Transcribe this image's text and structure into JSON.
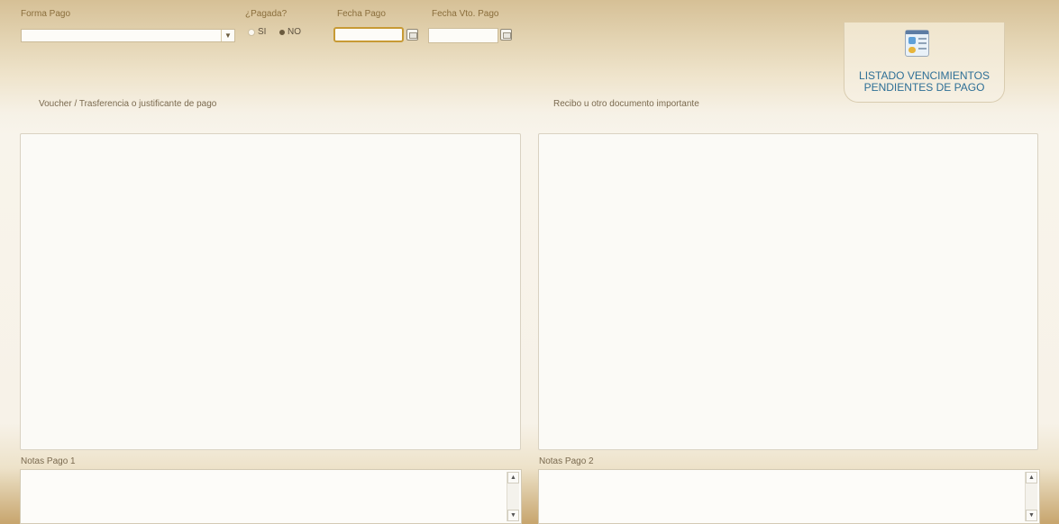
{
  "form": {
    "forma_pago": {
      "label": "Forma Pago",
      "value": ""
    },
    "pagada": {
      "label": "¿Pagada?",
      "options": [
        "SI",
        "NO"
      ],
      "selected": "NO"
    },
    "fecha_pago": {
      "label": "Fecha Pago",
      "value": ""
    },
    "fecha_vto": {
      "label": "Fecha Vto. Pago",
      "value": ""
    }
  },
  "report_button": {
    "icon": "report-list-icon",
    "line1": "LISTADO VENCIMIENTOS",
    "line2": "PENDIENTES DE PAGO"
  },
  "sections": {
    "voucher": "Voucher / Trasferencia o justificante de pago",
    "recibo": "Recibo u otro documento importante"
  },
  "notes": {
    "notas1": {
      "label": "Notas Pago 1",
      "value": ""
    },
    "notas2": {
      "label": "Notas Pago 2",
      "value": ""
    }
  },
  "colors": {
    "accent": "#2e6f96",
    "focus": "#c79a35"
  }
}
